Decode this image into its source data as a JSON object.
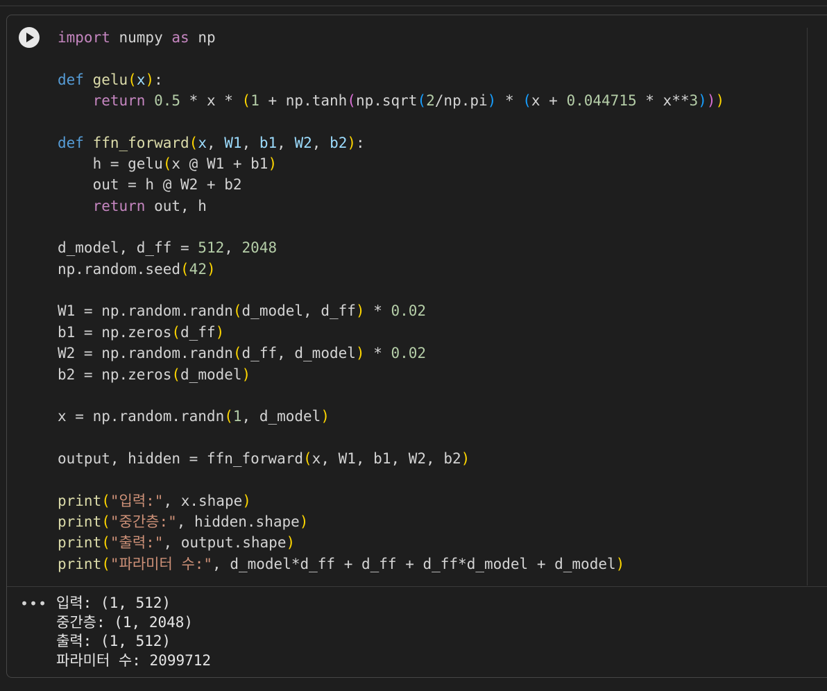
{
  "code_lines": [
    [
      {
        "t": "import",
        "c": "kw"
      },
      {
        "t": " numpy "
      },
      {
        "t": "as",
        "c": "kw"
      },
      {
        "t": " np"
      }
    ],
    [],
    [
      {
        "t": "def",
        "c": "kwb"
      },
      {
        "t": " "
      },
      {
        "t": "gelu",
        "c": "fn"
      },
      {
        "t": "(",
        "c": "b1"
      },
      {
        "t": "x",
        "c": "pr"
      },
      {
        "t": ")",
        "c": "b1"
      },
      {
        "t": ":"
      }
    ],
    [
      {
        "t": "    "
      },
      {
        "t": "return",
        "c": "kw"
      },
      {
        "t": " "
      },
      {
        "t": "0.5",
        "c": "num"
      },
      {
        "t": " * x * "
      },
      {
        "t": "(",
        "c": "b1"
      },
      {
        "t": "1",
        "c": "num"
      },
      {
        "t": " + np.tanh"
      },
      {
        "t": "(",
        "c": "b2"
      },
      {
        "t": "np.sqrt"
      },
      {
        "t": "(",
        "c": "b3"
      },
      {
        "t": "2",
        "c": "num"
      },
      {
        "t": "/np.pi"
      },
      {
        "t": ")",
        "c": "b3"
      },
      {
        "t": " * "
      },
      {
        "t": "(",
        "c": "b3"
      },
      {
        "t": "x + "
      },
      {
        "t": "0.044715",
        "c": "num"
      },
      {
        "t": " * x**"
      },
      {
        "t": "3",
        "c": "num"
      },
      {
        "t": ")",
        "c": "b3"
      },
      {
        "t": ")",
        "c": "b2"
      },
      {
        "t": ")",
        "c": "b1"
      }
    ],
    [],
    [
      {
        "t": "def",
        "c": "kwb"
      },
      {
        "t": " "
      },
      {
        "t": "ffn_forward",
        "c": "fn"
      },
      {
        "t": "(",
        "c": "b1"
      },
      {
        "t": "x",
        "c": "pr"
      },
      {
        "t": ", "
      },
      {
        "t": "W1",
        "c": "pr"
      },
      {
        "t": ", "
      },
      {
        "t": "b1",
        "c": "pr"
      },
      {
        "t": ", "
      },
      {
        "t": "W2",
        "c": "pr"
      },
      {
        "t": ", "
      },
      {
        "t": "b2",
        "c": "pr"
      },
      {
        "t": ")",
        "c": "b1"
      },
      {
        "t": ":"
      }
    ],
    [
      {
        "t": "    h = gelu"
      },
      {
        "t": "(",
        "c": "b1"
      },
      {
        "t": "x @ W1 + b1"
      },
      {
        "t": ")",
        "c": "b1"
      }
    ],
    [
      {
        "t": "    out = h @ W2 + b2"
      }
    ],
    [
      {
        "t": "    "
      },
      {
        "t": "return",
        "c": "kw"
      },
      {
        "t": " out, h"
      }
    ],
    [],
    [
      {
        "t": "d_model, d_ff = "
      },
      {
        "t": "512",
        "c": "num"
      },
      {
        "t": ", "
      },
      {
        "t": "2048",
        "c": "num"
      }
    ],
    [
      {
        "t": "np.random.seed"
      },
      {
        "t": "(",
        "c": "b1"
      },
      {
        "t": "42",
        "c": "num"
      },
      {
        "t": ")",
        "c": "b1"
      }
    ],
    [],
    [
      {
        "t": "W1 = np.random.randn"
      },
      {
        "t": "(",
        "c": "b1"
      },
      {
        "t": "d_model, d_ff"
      },
      {
        "t": ")",
        "c": "b1"
      },
      {
        "t": " * "
      },
      {
        "t": "0.02",
        "c": "num"
      }
    ],
    [
      {
        "t": "b1 = np.zeros"
      },
      {
        "t": "(",
        "c": "b1"
      },
      {
        "t": "d_ff"
      },
      {
        "t": ")",
        "c": "b1"
      }
    ],
    [
      {
        "t": "W2 = np.random.randn"
      },
      {
        "t": "(",
        "c": "b1"
      },
      {
        "t": "d_ff, d_model"
      },
      {
        "t": ")",
        "c": "b1"
      },
      {
        "t": " * "
      },
      {
        "t": "0.02",
        "c": "num"
      }
    ],
    [
      {
        "t": "b2 = np.zeros"
      },
      {
        "t": "(",
        "c": "b1"
      },
      {
        "t": "d_model"
      },
      {
        "t": ")",
        "c": "b1"
      }
    ],
    [],
    [
      {
        "t": "x = np.random.randn"
      },
      {
        "t": "(",
        "c": "b1"
      },
      {
        "t": "1",
        "c": "num"
      },
      {
        "t": ", d_model"
      },
      {
        "t": ")",
        "c": "b1"
      }
    ],
    [],
    [
      {
        "t": "output, hidden = ffn_forward"
      },
      {
        "t": "(",
        "c": "b1"
      },
      {
        "t": "x, W1, b1, W2, b2"
      },
      {
        "t": ")",
        "c": "b1"
      }
    ],
    [],
    [
      {
        "t": "print",
        "c": "fn"
      },
      {
        "t": "(",
        "c": "b1"
      },
      {
        "t": "\"입력:\"",
        "c": "str"
      },
      {
        "t": ", x.shape"
      },
      {
        "t": ")",
        "c": "b1"
      }
    ],
    [
      {
        "t": "print",
        "c": "fn"
      },
      {
        "t": "(",
        "c": "b1"
      },
      {
        "t": "\"중간층:\"",
        "c": "str"
      },
      {
        "t": ", hidden.shape"
      },
      {
        "t": ")",
        "c": "b1"
      }
    ],
    [
      {
        "t": "print",
        "c": "fn"
      },
      {
        "t": "(",
        "c": "b1"
      },
      {
        "t": "\"출력:\"",
        "c": "str"
      },
      {
        "t": ", output.shape"
      },
      {
        "t": ")",
        "c": "b1"
      }
    ],
    [
      {
        "t": "print",
        "c": "fn"
      },
      {
        "t": "(",
        "c": "b1"
      },
      {
        "t": "\"파라미터 수:\"",
        "c": "str"
      },
      {
        "t": ", d_model*d_ff + d_ff + d_ff*d_model + d_model"
      },
      {
        "t": ")",
        "c": "b1"
      }
    ]
  ],
  "output_menu": "•••",
  "output_lines": [
    "입력: (1, 512)",
    "중간층: (1, 2048)",
    "출력: (1, 512)",
    "파라미터 수: 2099712"
  ]
}
